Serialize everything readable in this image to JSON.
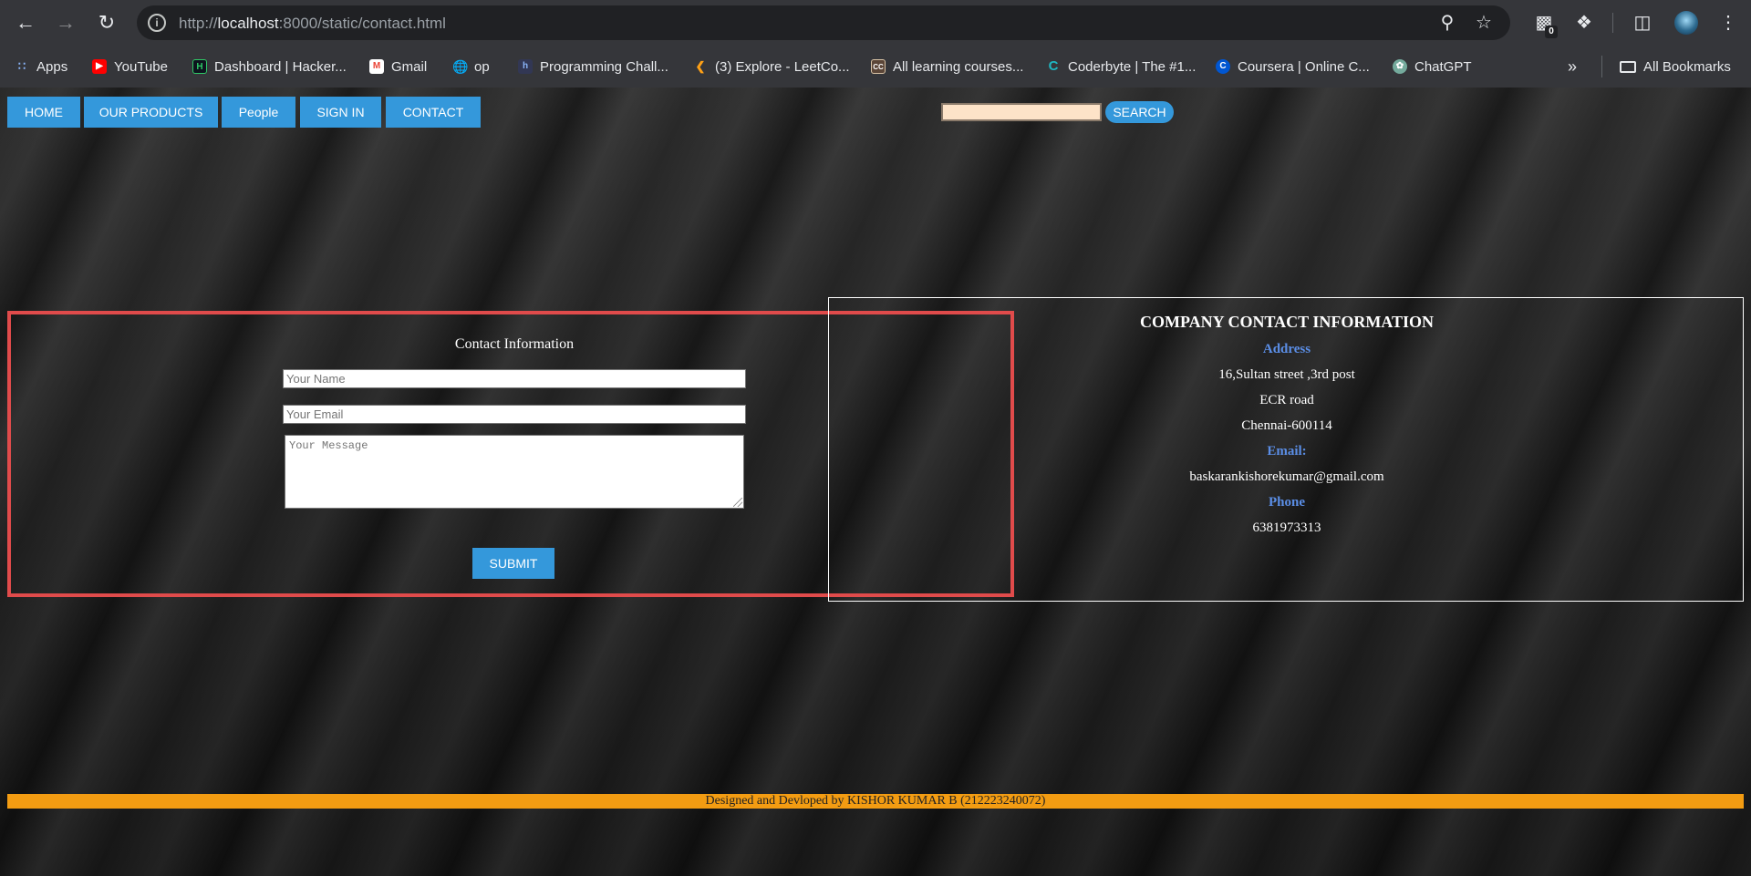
{
  "browser": {
    "url_prefix": "http://",
    "url_host": "localhost",
    "url_path": ":8000/static/contact.html",
    "extension_badge": "0",
    "bookmarks": [
      {
        "label": "Apps",
        "icon": "apps-grid-icon",
        "color": "#e8eaed"
      },
      {
        "label": "YouTube",
        "icon": "youtube-icon",
        "color": "#ff0000"
      },
      {
        "label": "Dashboard | Hacker...",
        "icon": "hackerrank-icon",
        "color": "#0e141e"
      },
      {
        "label": "Gmail",
        "icon": "gmail-icon",
        "color": "#ea4335"
      },
      {
        "label": "op",
        "icon": "globe-icon",
        "color": "#e8eaed"
      },
      {
        "label": "Programming Chall...",
        "icon": "hackerearth-icon",
        "color": "#323754"
      },
      {
        "label": "(3) Explore - LeetCo...",
        "icon": "leetcode-icon",
        "color": "#ffa116"
      },
      {
        "label": "All learning courses...",
        "icon": "codechef-icon",
        "color": "#5b4638"
      },
      {
        "label": "Coderbyte | The #1...",
        "icon": "coderbyte-icon",
        "color": "#1fb6c1"
      },
      {
        "label": "Coursera | Online C...",
        "icon": "coursera-icon",
        "color": "#0056d2"
      },
      {
        "label": "ChatGPT",
        "icon": "chatgpt-icon",
        "color": "#74aa9c"
      }
    ],
    "all_bookmarks_label": "All Bookmarks"
  },
  "nav": {
    "items": [
      "HOME",
      "OUR PRODUCTS",
      "People",
      "SIGN IN",
      "CONTACT"
    ],
    "search_button": "SEARCH",
    "search_value": ""
  },
  "form": {
    "title": "Contact Information",
    "name_placeholder": "Your Name",
    "email_placeholder": "Your Email",
    "message_placeholder": "Your Message",
    "submit_label": "SUBMIT"
  },
  "company": {
    "title": "COMPANY CONTACT INFORMATION",
    "address_label": "Address",
    "address_lines": [
      "16,Sultan street ,3rd post",
      "ECR road",
      "Chennai-600114"
    ],
    "email_label": "Email:",
    "email": "baskarankishorekumar@gmail.com",
    "phone_label": "Phone",
    "phone": "6381973313"
  },
  "footer": {
    "text": "Designed and Devloped by KISHOR KUMAR B (212223240072)"
  },
  "colors": {
    "nav_blue": "#3498db",
    "footer_orange": "#f39c12",
    "form_border": "#e04b4b",
    "label_blue": "#5b8ee6",
    "search_field": "#fde3c8"
  }
}
